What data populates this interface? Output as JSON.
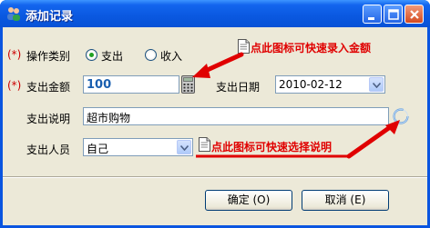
{
  "window": {
    "title": "添加记录"
  },
  "form": {
    "op_type": {
      "required_mark": "(*)",
      "label": "操作类别",
      "options": [
        {
          "label": "支出",
          "selected": true
        },
        {
          "label": "收入",
          "selected": false
        }
      ]
    },
    "amount": {
      "required_mark": "(*)",
      "label": "支出金额",
      "value": "100"
    },
    "date": {
      "label": "支出日期",
      "value": "2010-02-12"
    },
    "description": {
      "label": "支出说明",
      "value": "超市购物"
    },
    "person": {
      "label": "支出人员",
      "value": "自己"
    }
  },
  "hints": {
    "amount_hint": "点此图标可快速录入金额",
    "desc_hint": "点此图标可快速选择说明"
  },
  "buttons": {
    "ok": "确定 (O)",
    "cancel": "取消 (E)"
  },
  "colors": {
    "required": "#cc0000",
    "hint": "#e00000",
    "arrow": "#e00000",
    "amount": "#1a5fb0"
  }
}
